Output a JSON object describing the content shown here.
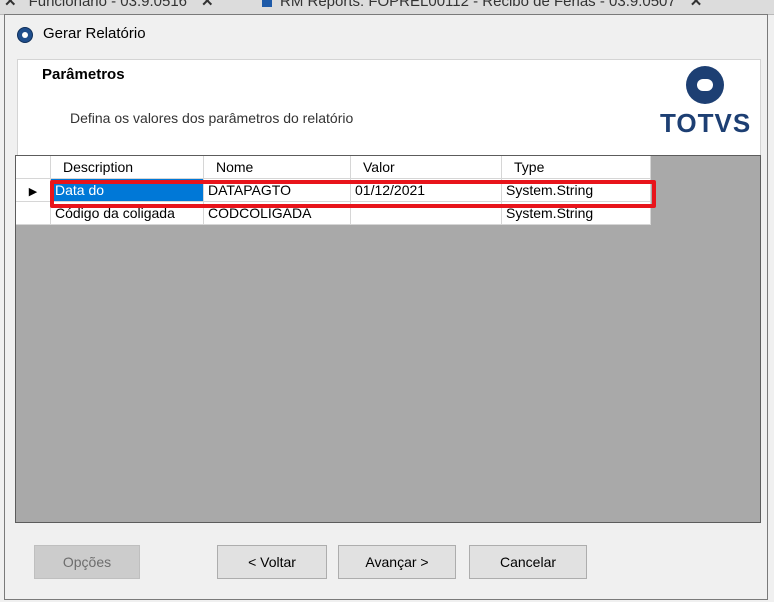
{
  "background_tabs": [
    {
      "label": "Funcionário - 03.9.0516",
      "close": "✕"
    },
    {
      "label": "RM Reports: FOPREL00112 - Recibo de Férias - 03.9.0507",
      "close": "✕"
    }
  ],
  "dialog": {
    "title": "Gerar Relatório"
  },
  "header": {
    "title": "Parâmetros",
    "description": "Defina os valores dos parâmetros do relatório",
    "logo_text": "TOTVS"
  },
  "grid": {
    "columns": [
      "Description",
      "Nome",
      "Valor",
      "Type"
    ],
    "rows": [
      {
        "indicator": "▶",
        "description": "Data do",
        "nome": "DATAPAGTO",
        "valor": "01/12/2021",
        "type": "System.String",
        "selected": true
      },
      {
        "indicator": "",
        "description": "Código da coligada",
        "nome": "CODCOLIGADA",
        "valor": "",
        "type": "System.String",
        "selected": false
      }
    ]
  },
  "buttons": {
    "opcoes": "Opções",
    "voltar": "< Voltar",
    "avancar": "Avançar >",
    "cancelar": "Cancelar"
  },
  "colors": {
    "highlight": "#e8141b",
    "selection": "#0078d7",
    "brand": "#1d3f73"
  }
}
